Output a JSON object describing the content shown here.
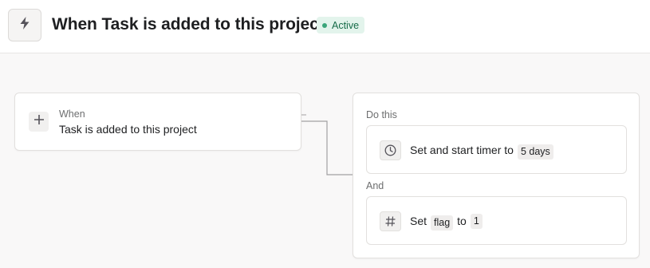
{
  "header": {
    "bolt_icon": "lightning-bolt-icon",
    "title": "When Task is added to this project",
    "status": "Active"
  },
  "trigger": {
    "add_icon": "plus-icon",
    "label": "When",
    "text": "Task is added to this project"
  },
  "actions": {
    "do_label": "Do this",
    "and_label": "And",
    "items": [
      {
        "icon": "clock-icon",
        "text": "Set and start timer to",
        "chip": "5 days"
      },
      {
        "icon": "hash-icon",
        "text_before": "Set",
        "chip_field": "flag",
        "text_mid": "to",
        "chip_value": "1"
      }
    ]
  },
  "colors": {
    "status_bg": "#e3f4ec",
    "status_text": "#166b48",
    "status_dot": "#3aa57a",
    "connector": "#a2a0a2"
  }
}
